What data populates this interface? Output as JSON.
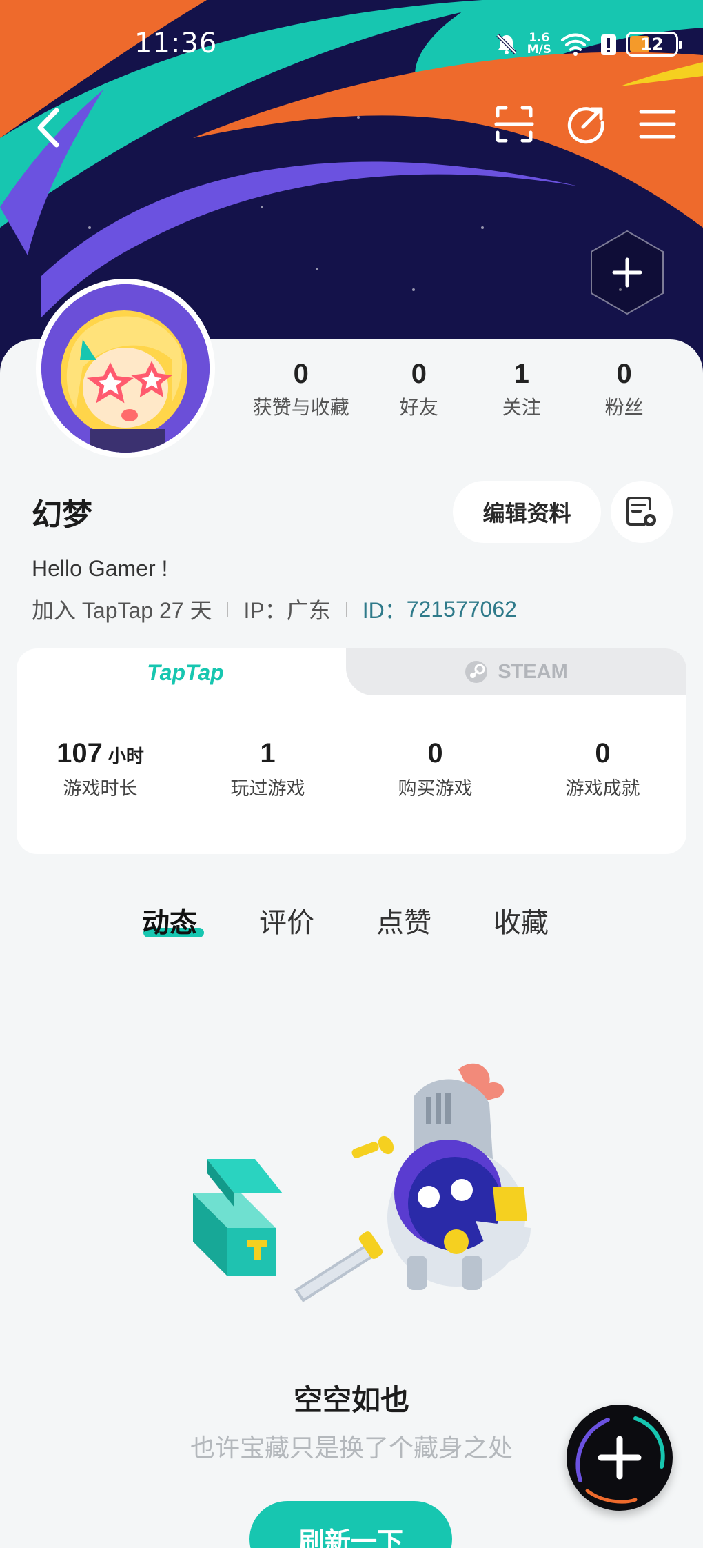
{
  "status_bar": {
    "time": "11:36",
    "net_speed_value": "1.6",
    "net_speed_unit": "M/S",
    "battery": "12",
    "icons": [
      "mute-icon",
      "wifi-icon",
      "signal-alert-icon",
      "battery-icon"
    ]
  },
  "header": {
    "back_icon": "chevron-left-icon",
    "actions": [
      "scan-icon",
      "share-icon",
      "menu-icon"
    ],
    "add_icon": "hexagon-plus-icon"
  },
  "profile": {
    "nickname": "幻梦",
    "bio": "Hello Gamer !",
    "joined": "加入 TapTap 27 天",
    "ip_label": "IP：",
    "ip_value": "广东",
    "id_label": "ID：",
    "id_value": "721577062",
    "edit_label": "编辑资料",
    "stats": [
      {
        "num": "0",
        "label": "获赞与收藏"
      },
      {
        "num": "0",
        "label": "好友"
      },
      {
        "num": "1",
        "label": "关注"
      },
      {
        "num": "0",
        "label": "粉丝"
      }
    ]
  },
  "platform": {
    "tabs": {
      "taptap": "TapTap",
      "steam": "STEAM"
    },
    "stats": [
      {
        "num": "107",
        "unit": "小时",
        "label": "游戏时长"
      },
      {
        "num": "1",
        "unit": "",
        "label": "玩过游戏"
      },
      {
        "num": "0",
        "unit": "",
        "label": "购买游戏"
      },
      {
        "num": "0",
        "unit": "",
        "label": "游戏成就"
      }
    ]
  },
  "feed_tabs": [
    "动态",
    "评价",
    "点赞",
    "收藏"
  ],
  "empty_state": {
    "title": "空空如也",
    "subtitle": "也许宝藏只是换了个藏身之处",
    "button": "刷新一下"
  },
  "colors": {
    "accent": "#17c6b0",
    "banner": "#14124a",
    "id_text": "#2f7a8a"
  }
}
